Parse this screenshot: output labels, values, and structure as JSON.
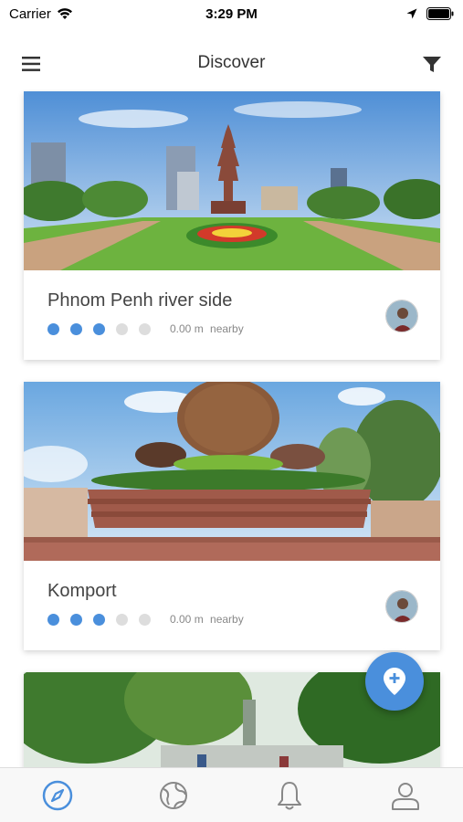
{
  "status_bar": {
    "carrier": "Carrier",
    "time": "3:29 PM"
  },
  "nav": {
    "title": "Discover",
    "left_icon": "hamburger-menu-icon",
    "right_icon": "filter-icon"
  },
  "places": [
    {
      "title": "Phnom Penh river side",
      "rating": 3,
      "rating_max": 5,
      "distance": "0.00 m",
      "distance_label": "nearby"
    },
    {
      "title": "Komport",
      "rating": 3,
      "rating_max": 5,
      "distance": "0.00 m",
      "distance_label": "nearby"
    },
    {
      "title": "",
      "rating": 0,
      "rating_max": 5,
      "distance": "",
      "distance_label": ""
    }
  ],
  "fab": {
    "icon": "add-location-icon"
  },
  "tabs": [
    {
      "icon": "compass-icon",
      "active": true
    },
    {
      "icon": "globe-icon",
      "active": false
    },
    {
      "icon": "bell-icon",
      "active": false
    },
    {
      "icon": "profile-icon",
      "active": false
    }
  ],
  "colors": {
    "accent": "#4a8fdc",
    "inactive_dot": "#dddddd",
    "tab_inactive": "#888888"
  }
}
